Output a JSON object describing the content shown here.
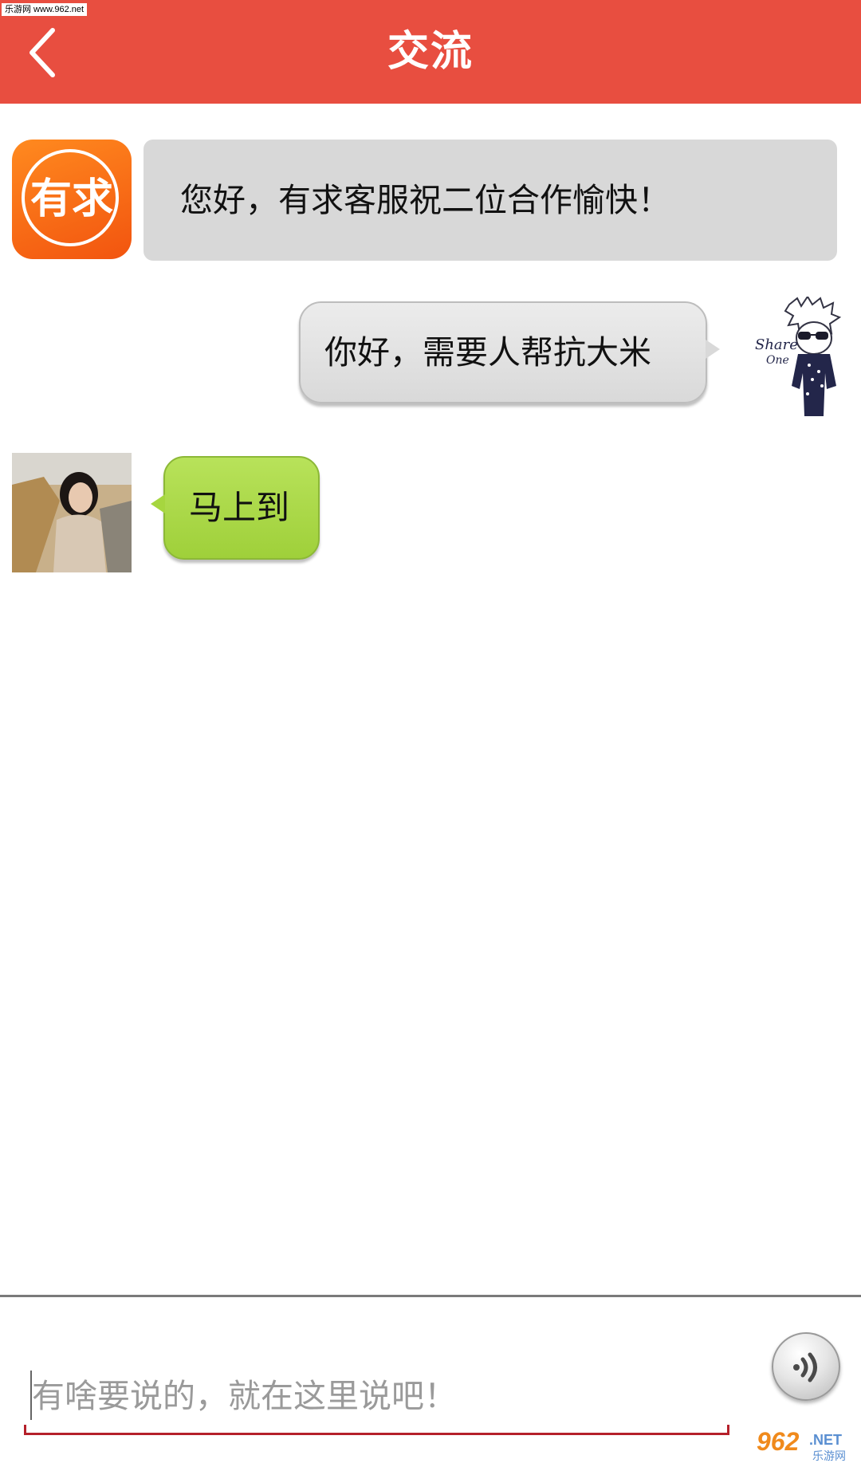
{
  "watermark": {
    "top": "乐游网 www.962.net",
    "bottom_brand": "962",
    "bottom_net": ".NET",
    "bottom_sub": "乐游网"
  },
  "header": {
    "title": "交流",
    "back_icon": "chevron-left-icon",
    "background": "#e84e40"
  },
  "messages": [
    {
      "side": "left",
      "sender": "service",
      "avatar_text": "有求",
      "text": "您好，有求客服祝二位合作愉快！",
      "bubble_color": "#d8d8d8"
    },
    {
      "side": "right",
      "sender": "user",
      "avatar_text": "Share One",
      "text": "你好，需要人帮抗大米",
      "bubble_color": "#e3e3e3"
    },
    {
      "side": "left",
      "sender": "helper",
      "text": "马上到",
      "bubble_color": "#a6d63f"
    }
  ],
  "composer": {
    "placeholder": "有啥要说的，就在这里说吧！",
    "value": "",
    "voice_icon": "voice-icon",
    "underline_color": "#b5202a"
  }
}
